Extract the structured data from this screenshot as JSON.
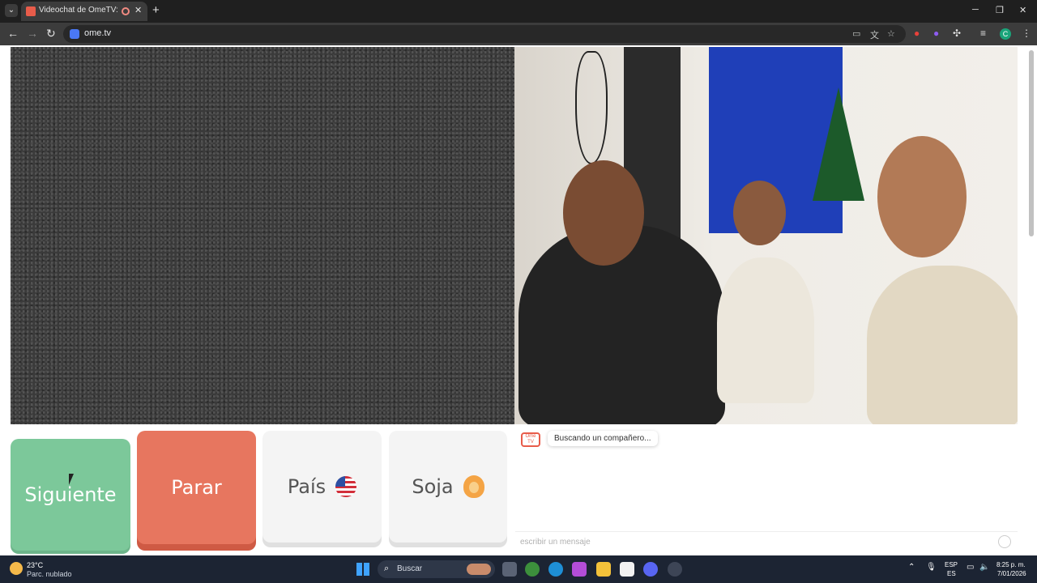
{
  "browser": {
    "tab": {
      "title": "Videochat de OmeTV: uno",
      "close": "✕"
    },
    "new_tab": "+",
    "window_controls": {
      "minimize": "─",
      "restore": "❐",
      "close": "✕"
    },
    "nav": {
      "back": "←",
      "forward": "→",
      "reload": "↻"
    },
    "url": "ome.tv",
    "profile_initial": "C",
    "icons": [
      "cast-icon",
      "translate-icon",
      "star-icon",
      "extension-red-icon",
      "extension-purple-icon",
      "puzzle-icon",
      "media-icon",
      "menu-icon"
    ]
  },
  "buttons": {
    "next": "Siguiente",
    "stop": "Parar",
    "country": "País",
    "gender": "Soja"
  },
  "chat": {
    "logo_text": "Ome TV",
    "status_message": "Buscando un compañero...",
    "input_placeholder": "escribir un mensaje"
  },
  "taskbar": {
    "weather_temp": "23°C",
    "weather_desc": "Parc. nublado",
    "search_label": "Buscar",
    "lang_primary": "ESP",
    "lang_secondary": "ES",
    "time": "8:25 p. m.",
    "date": "7/01/2026"
  },
  "colors": {
    "next_button": "#7cc89a",
    "stop_button": "#e7765f",
    "neutral_button": "#f4f4f4",
    "brand": "#e85c4a"
  }
}
